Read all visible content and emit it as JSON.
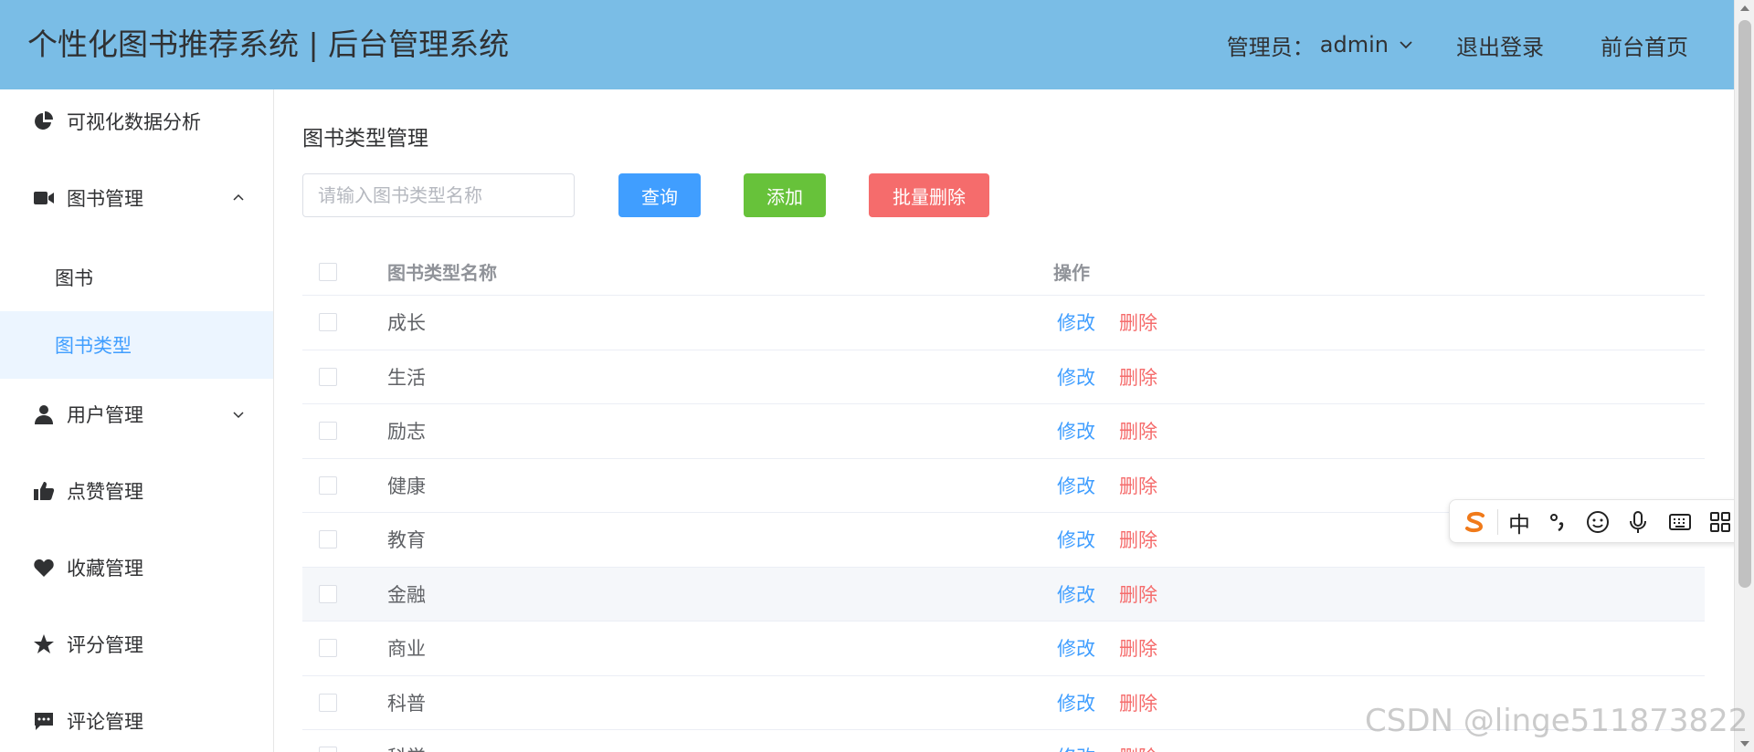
{
  "header": {
    "title": "个性化图书推荐系统 | 后台管理系统",
    "admin_label": "管理员：",
    "admin_name": "admin",
    "logout": "退出登录",
    "home": "前台首页",
    "background": "#7abde6"
  },
  "sidebar": {
    "items": [
      {
        "label": "可视化数据分析",
        "icon": "pie-chart-icon"
      },
      {
        "label": "图书管理",
        "icon": "video-camera-icon",
        "expanded": true
      },
      {
        "label": "图书",
        "sub": true
      },
      {
        "label": "图书类型",
        "sub": true,
        "active": true
      },
      {
        "label": "用户管理",
        "icon": "user-icon",
        "expanded": false
      },
      {
        "label": "点赞管理",
        "icon": "thumb-up-icon"
      },
      {
        "label": "收藏管理",
        "icon": "heart-icon"
      },
      {
        "label": "评分管理",
        "icon": "star-icon"
      },
      {
        "label": "评论管理",
        "icon": "comment-icon"
      }
    ]
  },
  "main": {
    "title": "图书类型管理",
    "search": {
      "placeholder": "请输入图书类型名称",
      "value": ""
    },
    "buttons": {
      "query": "查询",
      "add": "添加",
      "batch_delete": "批量删除"
    },
    "table": {
      "columns": [
        "图书类型名称",
        "操作"
      ],
      "rows": [
        "成长",
        "生活",
        "励志",
        "健康",
        "教育",
        "金融",
        "商业",
        "科普",
        "科学"
      ],
      "edit_label": "修改",
      "delete_label": "删除"
    }
  },
  "ime_toolbar": {
    "mode": "中",
    "icons": [
      "sogou-logo-icon",
      "punctuation-icon",
      "emoji-icon",
      "microphone-icon",
      "keyboard-icon",
      "grid-apps-icon"
    ]
  },
  "watermark": "CSDN @linge511873822",
  "colors": {
    "primary": "#409eff",
    "success": "#67c23a",
    "danger": "#f56c6c",
    "active_bg": "#ecf5ff"
  }
}
